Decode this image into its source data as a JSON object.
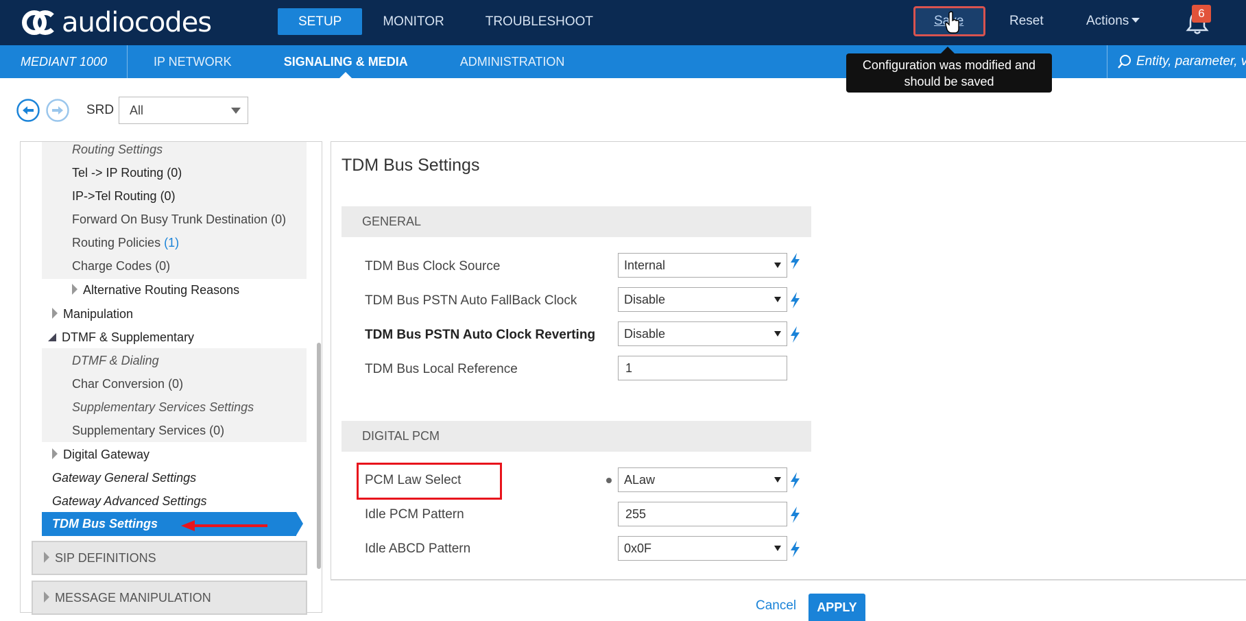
{
  "brand": {
    "logo_text": "audiocodes"
  },
  "top_nav": {
    "setup": "SETUP",
    "monitor": "MONITOR",
    "troubleshoot": "TROUBLESHOOT"
  },
  "top_actions": {
    "save": "Save",
    "reset": "Reset",
    "actions": "Actions",
    "notification_count": "6"
  },
  "tooltip": {
    "line1": "Configuration was modified and",
    "line2": "should be saved"
  },
  "sub_nav": {
    "device": "MEDIANT 1000",
    "items": [
      "IP NETWORK",
      "SIGNALING & MEDIA",
      "ADMINISTRATION"
    ],
    "active": "SIGNALING & MEDIA"
  },
  "search": {
    "placeholder": "Entity, parameter, value"
  },
  "toolbar": {
    "srd_label": "SRD",
    "srd_value": "All"
  },
  "tree": {
    "items": [
      {
        "label": "Routing Settings"
      },
      {
        "label": "Tel -> IP Routing (0)"
      },
      {
        "label": "IP->Tel Routing (0)"
      },
      {
        "label": "Forward On Busy Trunk Destination (0)"
      },
      {
        "label": "Routing Policies",
        "count": "(1)"
      },
      {
        "label": "Charge Codes (0)"
      },
      {
        "label": "Alternative Routing Reasons"
      },
      {
        "label": "Manipulation"
      },
      {
        "label": "DTMF & Supplementary"
      },
      {
        "label": "DTMF & Dialing"
      },
      {
        "label": "Char Conversion (0)"
      },
      {
        "label": "Supplementary Services Settings"
      },
      {
        "label": "Supplementary Services (0)"
      },
      {
        "label": "Digital Gateway"
      },
      {
        "label": "Gateway General Settings"
      },
      {
        "label": "Gateway Advanced Settings"
      },
      {
        "label": "TDM Bus Settings"
      }
    ],
    "sections": [
      "SIP DEFINITIONS",
      "MESSAGE MANIPULATION"
    ]
  },
  "page": {
    "title": "TDM Bus Settings",
    "groups": [
      {
        "header": "GENERAL",
        "fields": [
          {
            "label": "TDM Bus Clock Source",
            "value": "Internal"
          },
          {
            "label": "TDM Bus PSTN Auto FallBack Clock",
            "value": "Disable"
          },
          {
            "label": "TDM Bus PSTN Auto Clock Reverting",
            "value": "Disable"
          },
          {
            "label": "TDM Bus Local Reference",
            "value": "1"
          }
        ]
      },
      {
        "header": "DIGITAL PCM",
        "fields": [
          {
            "label": "PCM Law Select",
            "value": "ALaw"
          },
          {
            "label": "Idle PCM Pattern",
            "value": "255"
          },
          {
            "label": "Idle ABCD Pattern",
            "value": "0x0F"
          }
        ]
      }
    ],
    "cancel": "Cancel",
    "apply": "APPLY"
  },
  "colors": {
    "topbar": "#0b2a52",
    "accent": "#1a83d8",
    "highlight_red": "#e8141c",
    "badge": "#e2533a"
  }
}
